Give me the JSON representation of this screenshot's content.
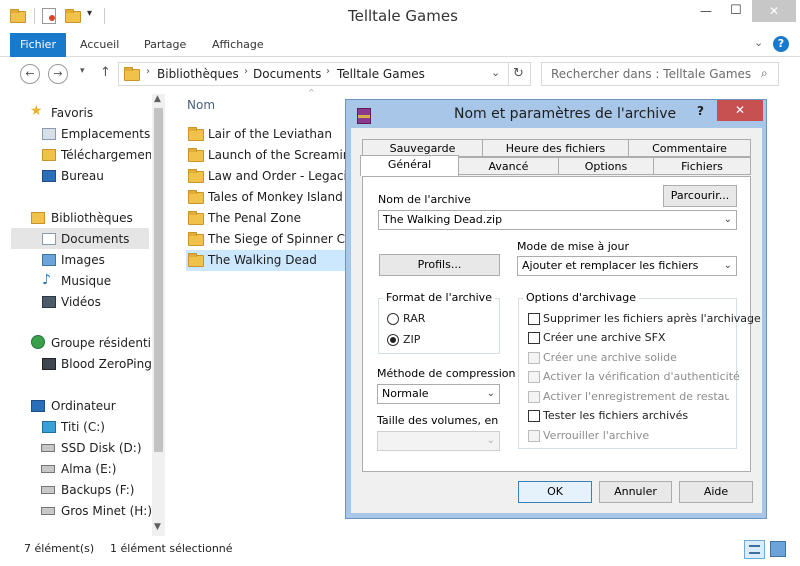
{
  "window": {
    "title": "Telltale Games",
    "minimize": "—",
    "maximize": "☐",
    "close": "✕"
  },
  "ribbon": {
    "tabs": [
      "Fichier",
      "Accueil",
      "Partage",
      "Affichage"
    ],
    "help": "?"
  },
  "address": {
    "crumbs": [
      "Bibliothèques",
      "Documents",
      "Telltale Games"
    ],
    "search_placeholder": "Rechercher dans : Telltale Games"
  },
  "nav": {
    "favorites": "Favoris",
    "fav_items": [
      "Emplacements ré",
      "Téléchargements",
      "Bureau"
    ],
    "libraries": "Bibliothèques",
    "lib_items": [
      "Documents",
      "Images",
      "Musique",
      "Vidéos"
    ],
    "homegroup": "Groupe résidentiel",
    "home_items": [
      "Blood ZeroPing"
    ],
    "computer": "Ordinateur",
    "drives": [
      "Titi (C:)",
      "SSD Disk (D:)",
      "Alma (E:)",
      "Backups (F:)",
      "Gros Minet (H:)"
    ]
  },
  "files": {
    "column": "Nom",
    "items": [
      "Lair of the Leviathan",
      "Launch of the Screaming N",
      "Law and Order - Legacies",
      "Tales of Monkey Island",
      "The Penal Zone",
      "The Siege of Spinner Cay",
      "The Walking Dead"
    ]
  },
  "status": {
    "count": "7 élément(s)",
    "selected": "1 élément sélectionné"
  },
  "dialog": {
    "title": "Nom et paramètres de l'archive",
    "help": "?",
    "close": "✕",
    "tabs_row1": [
      "Sauvegarde",
      "Heure des fichiers",
      "Commentaire"
    ],
    "tabs_row2": [
      "Général",
      "Avancé",
      "Options",
      "Fichiers"
    ],
    "archive_name_label": "Nom de l'archive",
    "archive_name": "The Walking Dead.zip",
    "browse": "Parcourir...",
    "update_mode_label": "Mode de mise à jour",
    "update_mode": "Ajouter et remplacer les fichiers",
    "profiles": "Profils...",
    "format_label": "Format de l'archive",
    "format_rar": "RAR",
    "format_zip": "ZIP",
    "method_label": "Méthode de compression",
    "method": "Normale",
    "volume_label": "Taille des volumes, en",
    "options_label": "Options d'archivage",
    "options": [
      {
        "label": "Supprimer les fichiers après l'archivage",
        "checked": false,
        "enabled": true
      },
      {
        "label": "Créer une archive SFX",
        "checked": false,
        "enabled": true
      },
      {
        "label": "Créer une archive solide",
        "checked": false,
        "enabled": false
      },
      {
        "label": "Activer la vérification d'authenticité",
        "checked": false,
        "enabled": false
      },
      {
        "label": "Activer l'enregistrement de restauratio",
        "checked": false,
        "enabled": false
      },
      {
        "label": "Tester les fichiers archivés",
        "checked": false,
        "enabled": true
      },
      {
        "label": "Verrouiller l'archive",
        "checked": false,
        "enabled": false
      }
    ],
    "ok": "OK",
    "cancel": "Annuler",
    "help_button": "Aide"
  }
}
